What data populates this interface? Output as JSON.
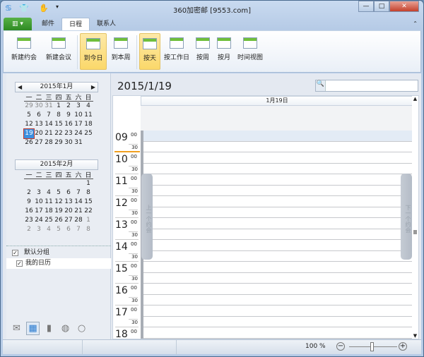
{
  "window": {
    "title": "360加密邮 [9553.com]",
    "minimize": "—",
    "maximize": "□",
    "close": "✕"
  },
  "quick_access": {
    "app_icon": "♋",
    "skin_icon": "👕",
    "hand_icon": "✋",
    "customize": "▾"
  },
  "tabs": {
    "file_label": "▥ ▾",
    "items": [
      {
        "label": "邮件"
      },
      {
        "label": "日程"
      },
      {
        "label": "联系人"
      }
    ],
    "active": "日程",
    "collapse_icon": "⌃"
  },
  "ribbon": {
    "buttons": [
      {
        "label": "新建约会"
      },
      {
        "label": "新建会议"
      },
      {
        "label": "到今日"
      },
      {
        "label": "到本周"
      },
      {
        "label": "按天"
      },
      {
        "label": "按工作日"
      },
      {
        "label": "按周"
      },
      {
        "label": "按月"
      },
      {
        "label": "时间视图"
      }
    ]
  },
  "mini_calendars": [
    {
      "title": "2015年1月",
      "prev": "◀",
      "next": "▶",
      "weekdays": [
        "一",
        "二",
        "三",
        "四",
        "五",
        "六",
        "日"
      ],
      "days": [
        [
          "29",
          1
        ],
        [
          "30",
          1
        ],
        [
          "31",
          1
        ],
        [
          "1",
          0
        ],
        [
          "2",
          0
        ],
        [
          "3",
          0
        ],
        [
          "4",
          0
        ],
        [
          "5",
          0
        ],
        [
          "6",
          0
        ],
        [
          "7",
          0
        ],
        [
          "8",
          0
        ],
        [
          "9",
          0
        ],
        [
          "10",
          0
        ],
        [
          "11",
          0
        ],
        [
          "12",
          0
        ],
        [
          "13",
          0
        ],
        [
          "14",
          0
        ],
        [
          "15",
          0
        ],
        [
          "16",
          0
        ],
        [
          "17",
          0
        ],
        [
          "18",
          0
        ],
        [
          "19",
          2
        ],
        [
          "20",
          0
        ],
        [
          "21",
          0
        ],
        [
          "22",
          0
        ],
        [
          "23",
          0
        ],
        [
          "24",
          0
        ],
        [
          "25",
          0
        ],
        [
          "26",
          0
        ],
        [
          "27",
          0
        ],
        [
          "28",
          0
        ],
        [
          "29",
          0
        ],
        [
          "30",
          0
        ],
        [
          "31",
          0
        ]
      ]
    },
    {
      "title": "2015年2月",
      "weekdays": [
        "一",
        "二",
        "三",
        "四",
        "五",
        "六",
        "日"
      ],
      "days": [
        [
          "",
          0
        ],
        [
          "",
          0
        ],
        [
          "",
          0
        ],
        [
          "",
          0
        ],
        [
          "",
          0
        ],
        [
          "",
          0
        ],
        [
          "1",
          0
        ],
        [
          "2",
          0
        ],
        [
          "3",
          0
        ],
        [
          "4",
          0
        ],
        [
          "5",
          0
        ],
        [
          "6",
          0
        ],
        [
          "7",
          0
        ],
        [
          "8",
          0
        ],
        [
          "9",
          0
        ],
        [
          "10",
          0
        ],
        [
          "11",
          0
        ],
        [
          "12",
          0
        ],
        [
          "13",
          0
        ],
        [
          "14",
          0
        ],
        [
          "15",
          0
        ],
        [
          "16",
          0
        ],
        [
          "17",
          0
        ],
        [
          "18",
          0
        ],
        [
          "19",
          0
        ],
        [
          "20",
          0
        ],
        [
          "21",
          0
        ],
        [
          "22",
          0
        ],
        [
          "23",
          0
        ],
        [
          "24",
          0
        ],
        [
          "25",
          0
        ],
        [
          "26",
          0
        ],
        [
          "27",
          0
        ],
        [
          "28",
          0
        ],
        [
          "1",
          1
        ],
        [
          "2",
          1
        ],
        [
          "3",
          1
        ],
        [
          "4",
          1
        ],
        [
          "5",
          1
        ],
        [
          "6",
          1
        ],
        [
          "7",
          1
        ],
        [
          "8",
          1
        ]
      ]
    }
  ],
  "groups": [
    {
      "label": "默认分组",
      "checked": "✓"
    },
    {
      "label": "我的日历",
      "checked": "✓"
    }
  ],
  "nav_icons": {
    "mail": "✉",
    "calendar": "▦",
    "contacts": "▮",
    "web": "◍",
    "search": "○"
  },
  "main": {
    "date_title": "2015/1/19",
    "search_placeholder": "",
    "search_icon": "🔍",
    "day_header": "1月19日",
    "hours": [
      "09",
      "10",
      "11",
      "12",
      "13",
      "14",
      "15",
      "16",
      "17",
      "18"
    ],
    "m00": "00",
    "m30": "30",
    "prev_appt": "上一个约会",
    "next_appt": "下一个约会",
    "scroll_up": "▲",
    "scroll_down": "▼"
  },
  "status": {
    "zoom": "100 %",
    "zoom_minus": "−",
    "zoom_plus": "+",
    "zoom_level": 100
  }
}
